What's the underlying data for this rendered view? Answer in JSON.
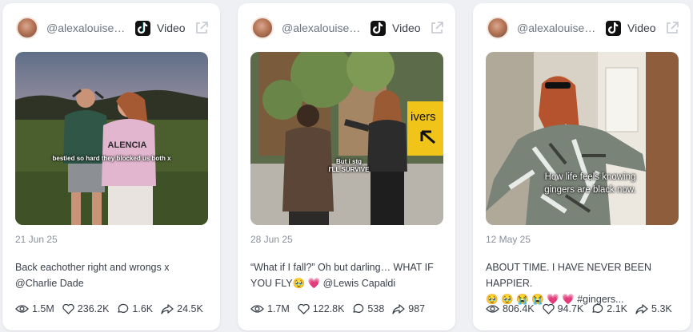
{
  "cards": [
    {
      "handle": "@alexalouisew...",
      "platform": "Video",
      "thumb_caption": "bestied so hard they blocked us both x",
      "date": "21 Jun 25",
      "desc_line1": "Back eachother right and wrongs x",
      "desc_line2": "@Charlie Dade",
      "views": "1.5M",
      "likes": "236.2K",
      "comments": "1.6K",
      "shares": "24.5K"
    },
    {
      "handle": "@alexalouisew...",
      "platform": "Video",
      "thumb_caption_1": "But i stg",
      "thumb_caption_2": "I'LL SURVIVE",
      "sign_text": "ivers",
      "date": "28 Jun 25",
      "desc_line1": "“What if I fall?” Oh but darling… WHAT IF",
      "desc_line2_pre": "YOU FLY",
      "desc_emoji": "🥹 💗",
      "desc_line2_post": "@Lewis Capaldi",
      "views": "1.7M",
      "likes": "122.8K",
      "comments": "538",
      "shares": "987"
    },
    {
      "handle": "@alexalouisew...",
      "platform": "Video",
      "thumb_caption_1": "How life feels knowing",
      "thumb_caption_2": "gingers are black now.",
      "date": "12 May 25",
      "desc_line1": "ABOUT TIME. I HAVE NEVER BEEN HAPPIER.",
      "desc_emoji": "🥹 🥹 😭 😭 💗 💗",
      "desc_line2_post": "#gingers...",
      "views": "806.4K",
      "likes": "94.7K",
      "comments": "2.1K",
      "shares": "5.3K"
    }
  ]
}
